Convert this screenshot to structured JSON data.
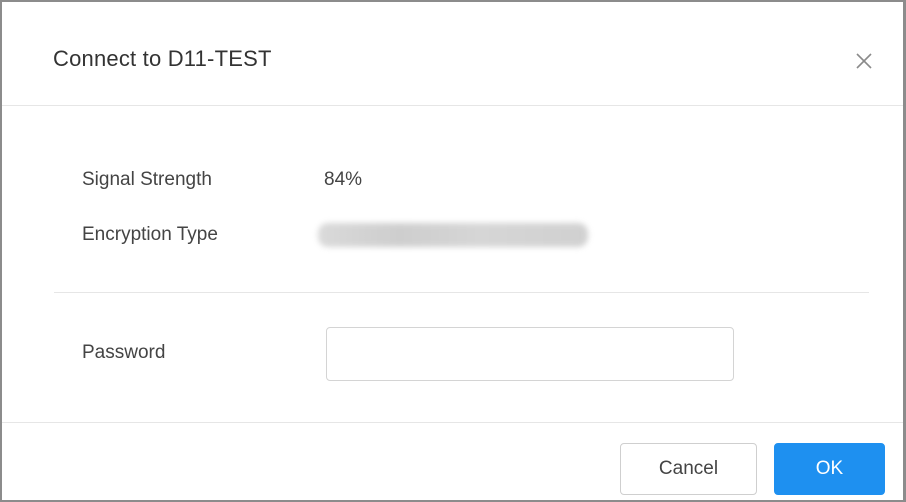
{
  "dialog": {
    "title": "Connect to D11-TEST",
    "close_icon": "close-icon"
  },
  "info": {
    "signal_strength_label": "Signal Strength",
    "signal_strength_value": "84%",
    "encryption_type_label": "Encryption Type",
    "encryption_type_value": ""
  },
  "password": {
    "label": "Password",
    "value": "",
    "placeholder": ""
  },
  "footer": {
    "cancel_label": "Cancel",
    "ok_label": "OK"
  },
  "colors": {
    "primary": "#1e90f0",
    "text": "#333333",
    "border": "#d4d4d4"
  }
}
